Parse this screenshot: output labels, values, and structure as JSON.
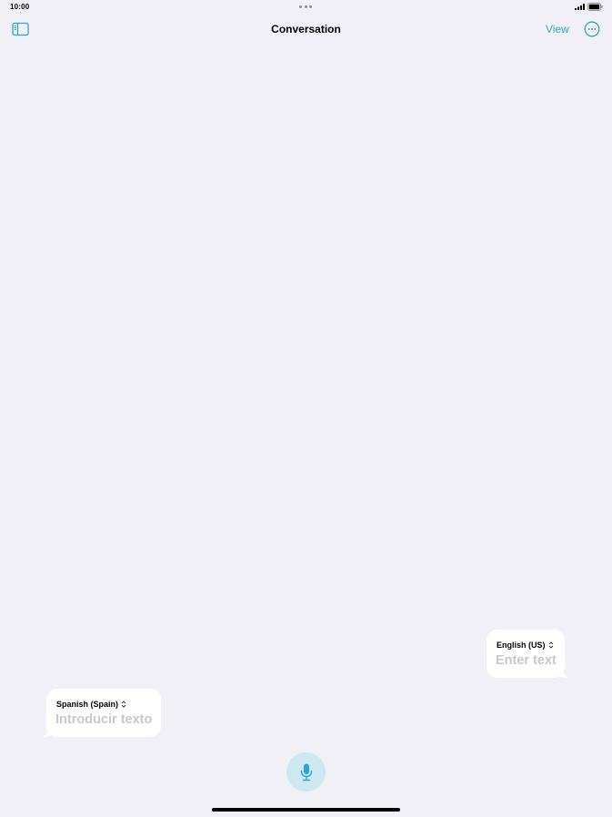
{
  "status_bar": {
    "time": "10:00"
  },
  "nav": {
    "title": "Conversation",
    "view_label": "View"
  },
  "bubbles": {
    "english": {
      "language": "English (US)",
      "placeholder": "Enter text"
    },
    "spanish": {
      "language": "Spanish (Spain)",
      "placeholder": "Introducir texto"
    }
  },
  "icons": {
    "sidebar": "sidebar-icon",
    "more": "ellipsis-circle-icon",
    "chevron": "chevron-up-down-icon",
    "mic": "microphone-icon"
  },
  "colors": {
    "background": "#f1f0f6",
    "accent": "#2aa7cc",
    "mic_background": "#cde8f1",
    "placeholder": "#c7c7cc"
  }
}
